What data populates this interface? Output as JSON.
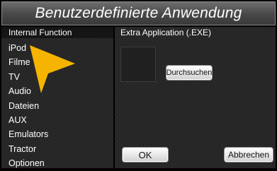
{
  "title": "Benutzerdefinierte Anwendung",
  "left_panel": {
    "header": "Internal Function",
    "items": [
      "iPod",
      "Filme",
      "TV",
      "Audio",
      "Dateien",
      "AUX",
      "Emulators",
      "Tractor",
      "Optionen"
    ]
  },
  "right_panel": {
    "header": "Extra Application (.EXE)",
    "browse_label": "Durchsuchen",
    "ok_label": "OK",
    "cancel_label": "Abbrechen"
  },
  "colors": {
    "pointer": "#f5b400",
    "background": "#000000"
  }
}
